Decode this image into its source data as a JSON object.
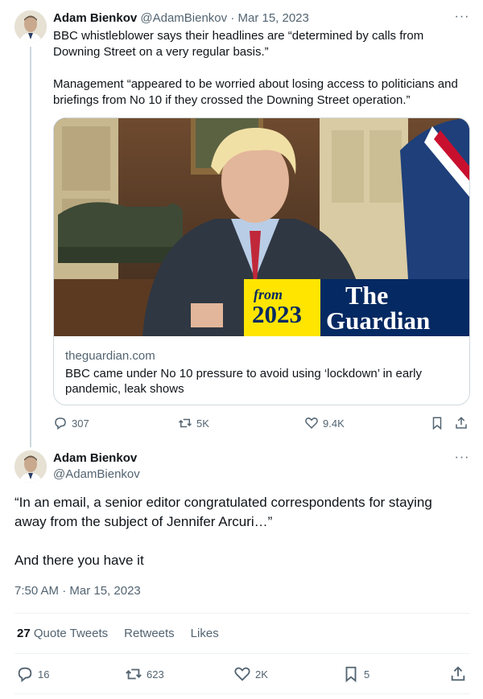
{
  "tweet1": {
    "author_name": "Adam Bienkov",
    "handle_date": "@AdamBienkov · Mar 15, 2023",
    "text": "BBC whistleblower says their headlines are “determined by calls from Downing Street on a very regular basis.”\n\nManagement “appeared to be worried about losing access to politicians and briefings from No 10 if they crossed the Downing Street operation.”",
    "card": {
      "badge_from": "from",
      "badge_year": "2023",
      "logo_line1": "The",
      "logo_line2": "Guardian",
      "domain": "theguardian.com",
      "title": "BBC came under No 10 pressure to avoid using ‘lockdown’ in early pandemic, leak shows"
    },
    "actions": {
      "replies": "307",
      "retweets": "5K",
      "likes": "9.4K"
    }
  },
  "tweet2": {
    "author_name": "Adam Bienkov",
    "handle": "@AdamBienkov",
    "text": "“In an email, a senior editor congratulated correspondents for staying away from the subject of Jennifer Arcuri…”\n\nAnd there you have it",
    "timestamp": "7:50 AM · Mar 15, 2023",
    "stats": {
      "quote_count": "27",
      "quote_label": "Quote Tweets",
      "retweets_label": "Retweets",
      "likes_label": "Likes"
    },
    "actions": {
      "replies": "16",
      "retweets": "623",
      "likes": "2K",
      "bookmarks": "5"
    }
  },
  "more_glyph": "···",
  "colors": {
    "text": "#0f1419",
    "secondary": "#536471",
    "border": "#cfd9de",
    "guardian_blue": "#052962",
    "guardian_yellow": "#ffe500"
  }
}
